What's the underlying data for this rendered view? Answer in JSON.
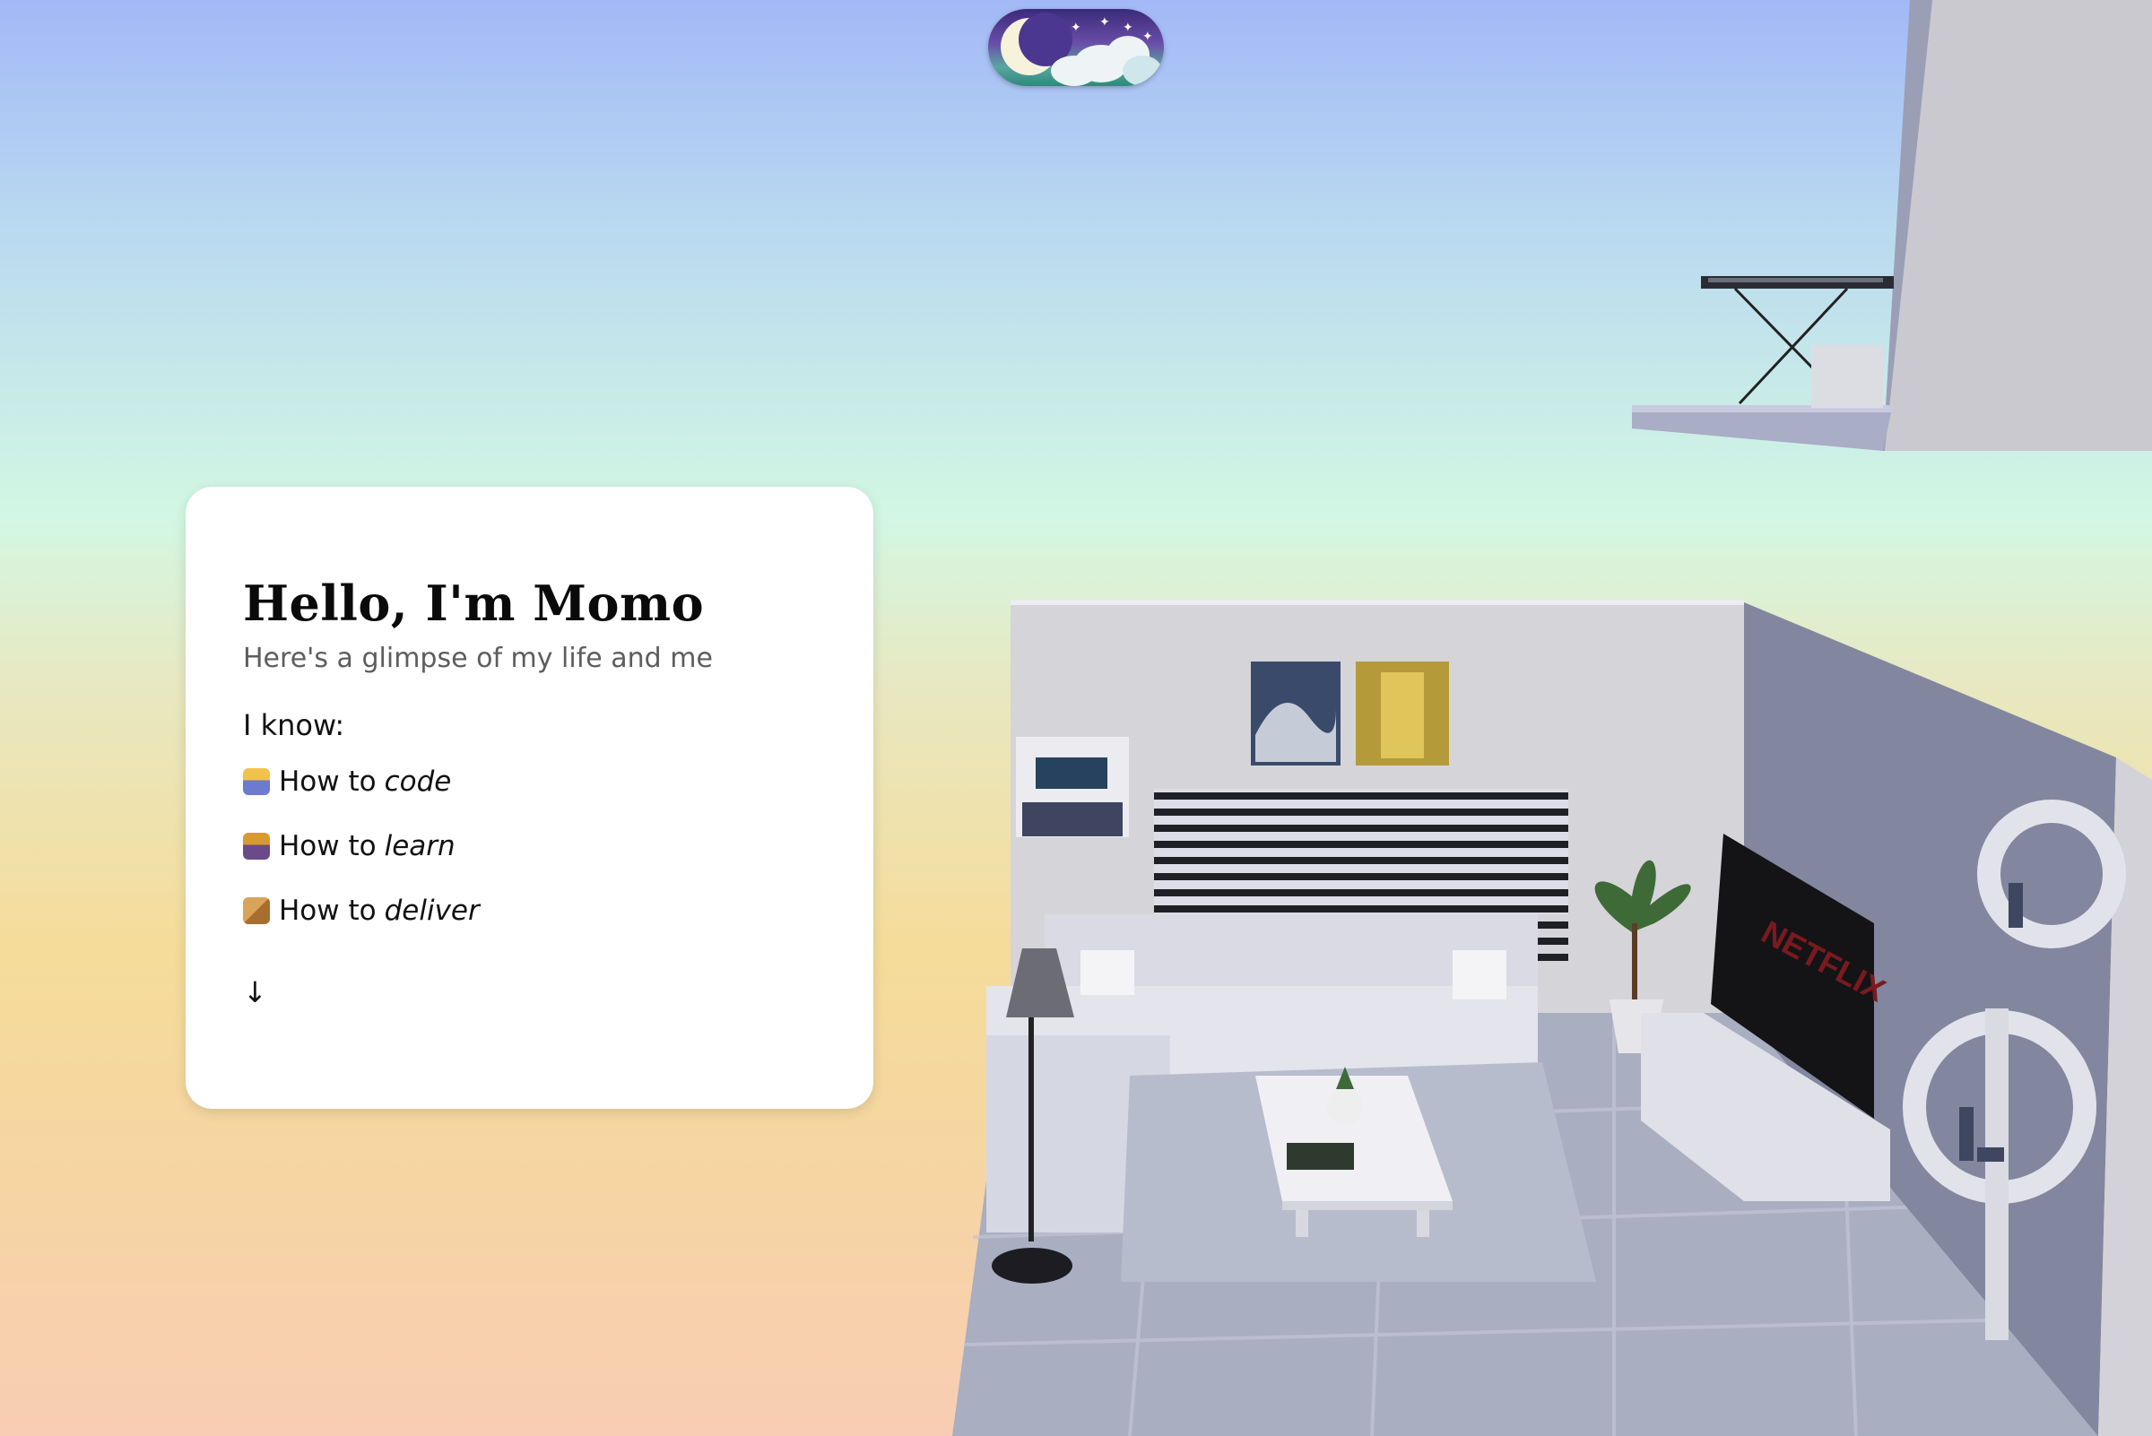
{
  "theme_toggle": {
    "icon": "moon-clouds-icon",
    "colors": {
      "sky_top": "#3a2a7a",
      "sky_bottom": "#2d8a7a",
      "moon": "#f6f2dc"
    }
  },
  "intro": {
    "title": "Hello, I'm Momo",
    "subtitle": "Here's a glimpse of my life and me",
    "know_label": "I know:",
    "skills": [
      {
        "icon": "technologist-icon",
        "prefix": "How to",
        "verb": "code"
      },
      {
        "icon": "teacher-icon",
        "prefix": "How to",
        "verb": "learn"
      },
      {
        "icon": "package-icon",
        "prefix": "How to",
        "verb": "deliver"
      }
    ],
    "scroll_arrow": "↓"
  },
  "scene": {
    "tv_brand": "NETFLIX"
  },
  "colors": {
    "gradient_top": "#a3b8f7",
    "gradient_mid": "#d3f7e3",
    "gradient_bottom": "#f8cdb4"
  }
}
